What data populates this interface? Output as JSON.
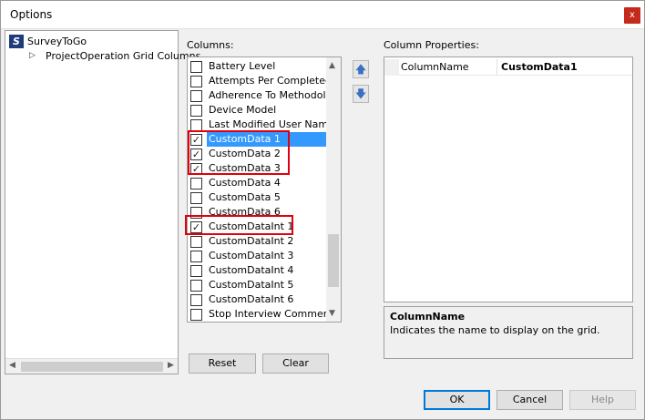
{
  "window": {
    "title": "Options",
    "close_glyph": "x"
  },
  "tree": {
    "root_label": "SurveyToGo",
    "root_icon": "S",
    "child_label": "ProjectOperation Grid Columns"
  },
  "columns": {
    "label": "Columns:",
    "items": [
      {
        "label": "Battery Level",
        "checked": false
      },
      {
        "label": "Attempts Per Completed I",
        "checked": false
      },
      {
        "label": "Adherence To Methodolog",
        "checked": false
      },
      {
        "label": "Device Model",
        "checked": false
      },
      {
        "label": "Last Modified User Name",
        "checked": false
      },
      {
        "label": "CustomData 1",
        "checked": true,
        "selected": true
      },
      {
        "label": "CustomData 2",
        "checked": true
      },
      {
        "label": "CustomData 3",
        "checked": true
      },
      {
        "label": "CustomData 4",
        "checked": false
      },
      {
        "label": "CustomData 5",
        "checked": false
      },
      {
        "label": "CustomData 6",
        "checked": false
      },
      {
        "label": "CustomDataInt 1",
        "checked": true
      },
      {
        "label": "CustomDataInt 2",
        "checked": false
      },
      {
        "label": "CustomDataInt 3",
        "checked": false
      },
      {
        "label": "CustomDataInt 4",
        "checked": false
      },
      {
        "label": "CustomDataInt 5",
        "checked": false
      },
      {
        "label": "CustomDataInt 6",
        "checked": false
      },
      {
        "label": "Stop Interview Comment",
        "checked": false
      }
    ]
  },
  "properties": {
    "label": "Column Properties:",
    "row_name": "ColumnName",
    "row_value": "CustomData1",
    "desc_title": "ColumnName",
    "desc_text": "Indicates the name to display on the grid."
  },
  "buttons": {
    "reset": "Reset",
    "clear": "Clear",
    "ok": "OK",
    "cancel": "Cancel",
    "help": "Help"
  },
  "colors": {
    "selection": "#3399ff",
    "highlight_box": "#e0000e",
    "app_icon": "#1e3b7a",
    "close_button": "#c42b1c"
  },
  "icons": {
    "move_up": "arrow-up-icon",
    "move_down": "arrow-down-icon",
    "tree_expand": "triangle-right-icon",
    "checkmark": "check-icon"
  }
}
